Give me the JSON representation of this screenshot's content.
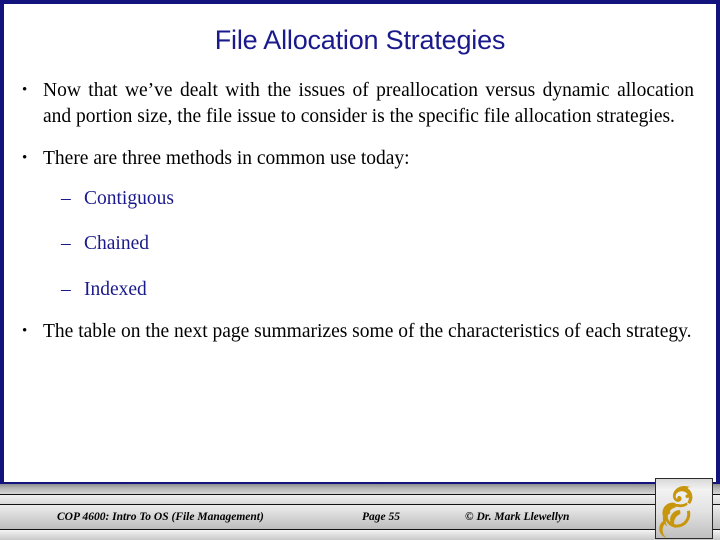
{
  "slide": {
    "title": "File Allocation Strategies",
    "accent_navy": "#1a1a8c",
    "frame_color": "#13137e",
    "body_color": "#000000",
    "logo_color": "#c8960c"
  },
  "body": {
    "bullets": [
      {
        "level": 1,
        "marker": "•",
        "text": "Now that we’ve dealt with the issues of preallocation versus dynamic allocation and portion size, the file issue to consider is the specific file allocation strategies."
      },
      {
        "level": 1,
        "marker": "•",
        "text": "There are three methods in common use today:"
      },
      {
        "level": 2,
        "marker": "–",
        "text": "Contiguous"
      },
      {
        "level": 2,
        "marker": "–",
        "text": "Chained"
      },
      {
        "level": 2,
        "marker": "–",
        "text": "Indexed"
      },
      {
        "level": 1,
        "marker": "•",
        "text": "The table on the next page summarizes some of the characteristics of each strategy."
      }
    ]
  },
  "footer": {
    "course": "COP 4600: Intro To OS  (File Management)",
    "page": "Page 55",
    "copyright": "© Dr. Mark Llewellyn",
    "logo_name": "ucf-pegasus-logo"
  }
}
